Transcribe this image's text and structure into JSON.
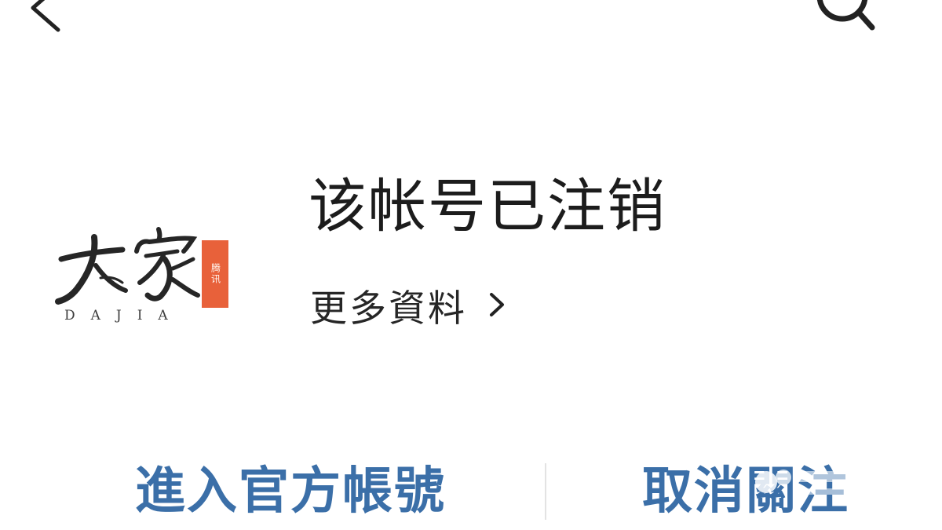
{
  "header": {
    "back_icon": "chevron-left-icon",
    "search_icon": "search-icon"
  },
  "logo": {
    "wordmark": "大家",
    "letters": "DAJIA",
    "seal_text": "腾讯",
    "seal_color": "#e8613a"
  },
  "account": {
    "name": "该帐号已注销",
    "more_info_label": "更多資料"
  },
  "actions": {
    "enter_account_label": "進入官方帳號",
    "unfollow_label": "取消關注",
    "action_color": "#3b6fa8"
  }
}
